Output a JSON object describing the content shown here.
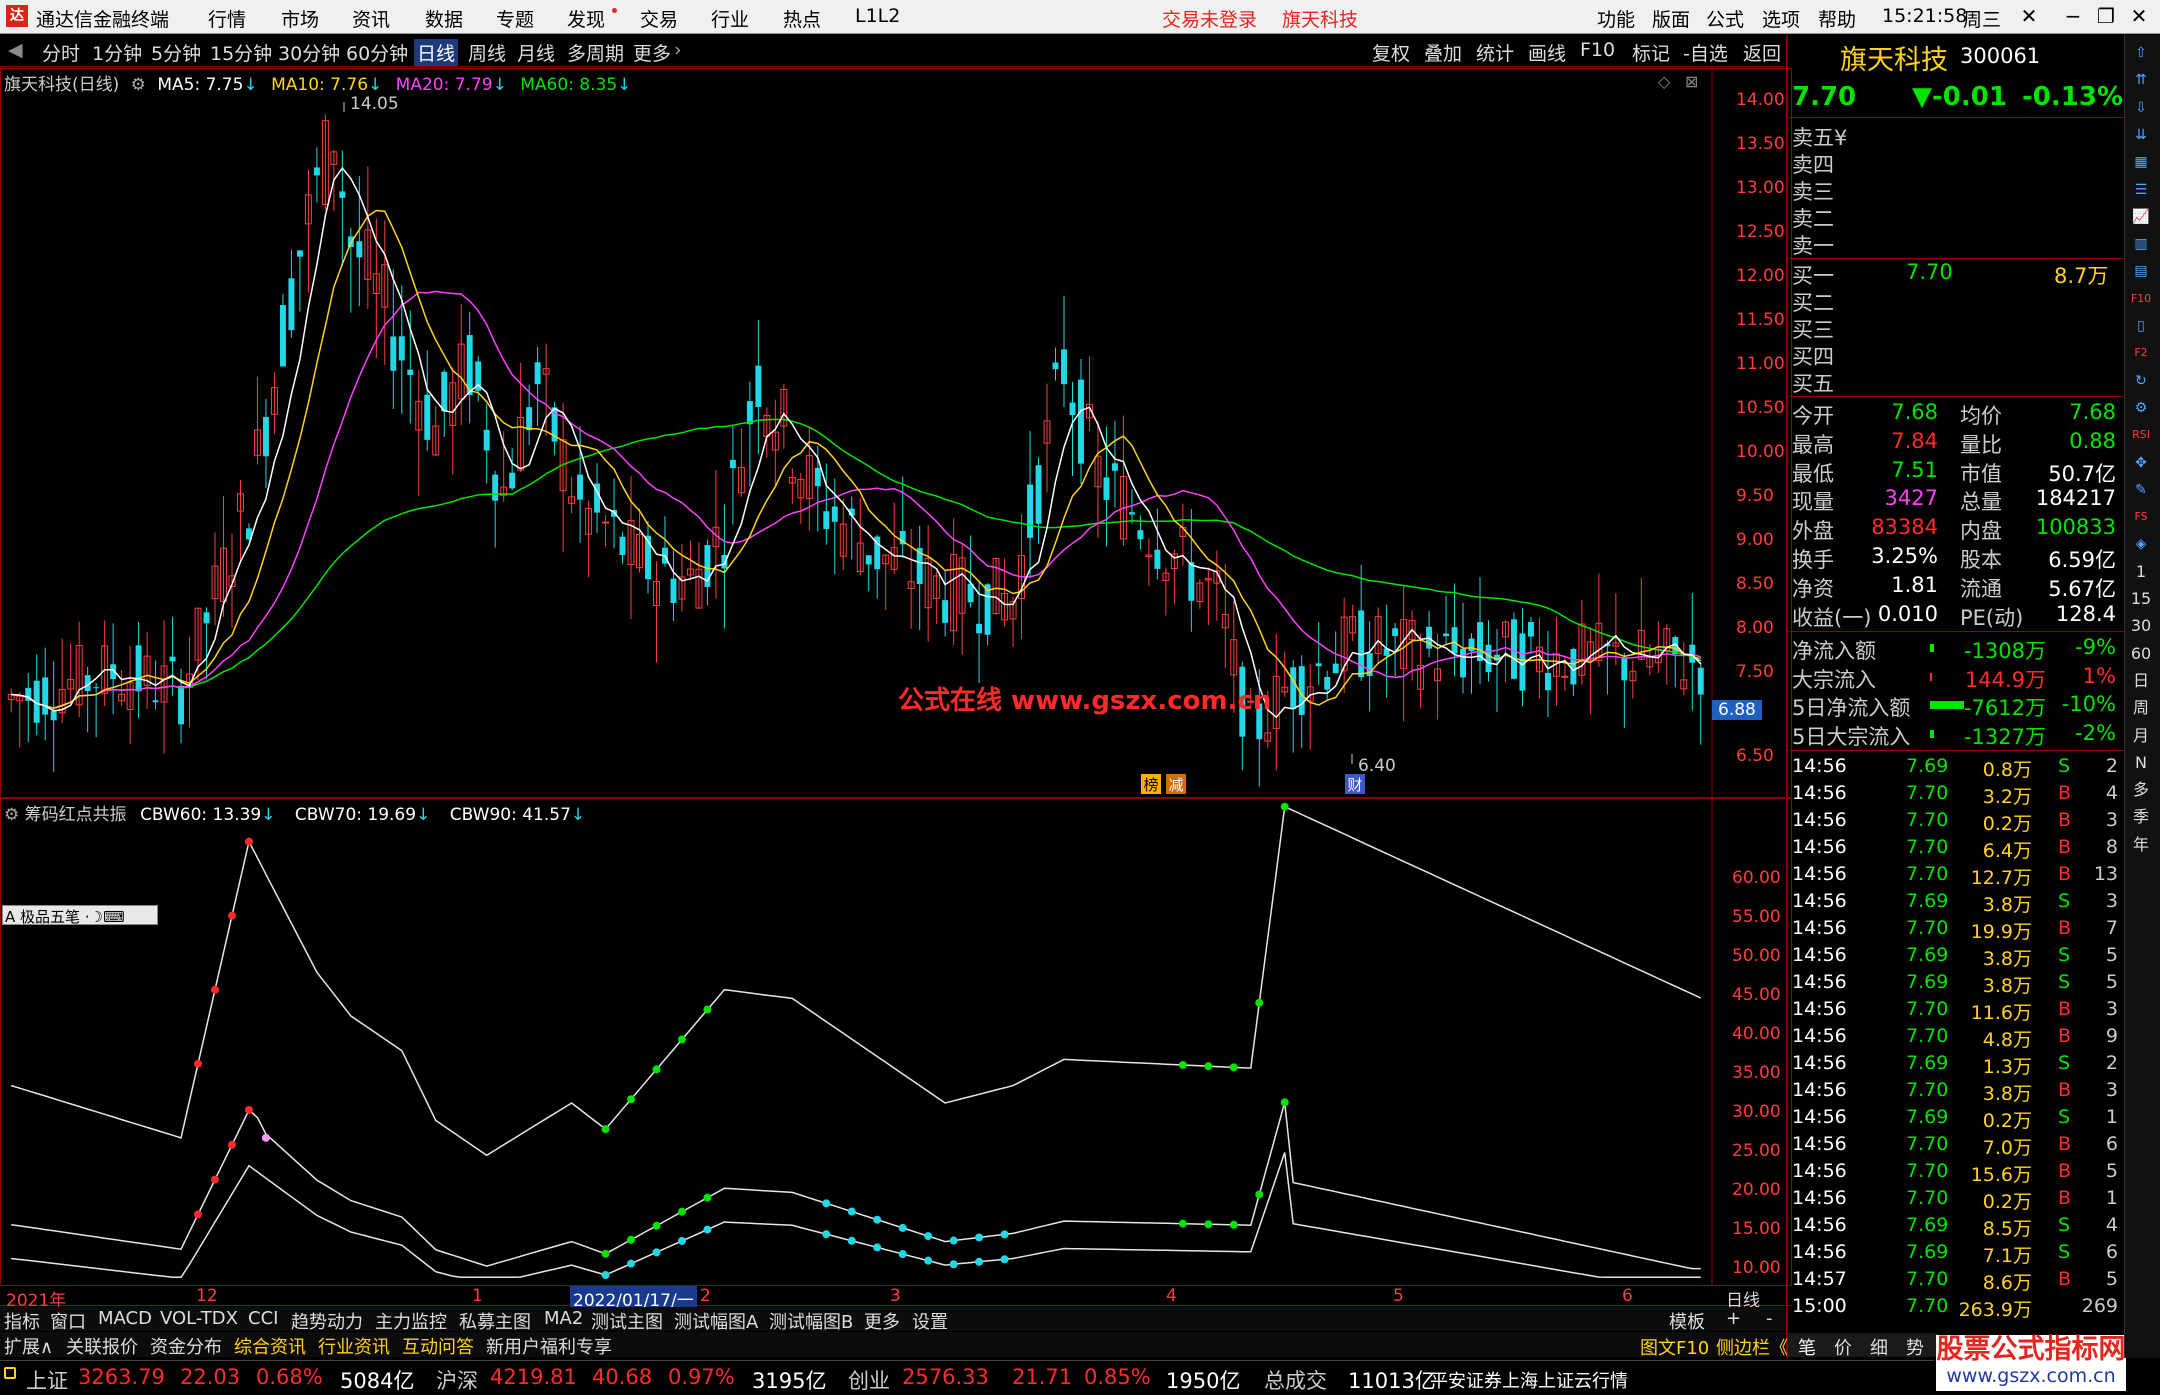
{
  "app": {
    "title": "通达信金融终端",
    "logo": "app-logo"
  },
  "menu": {
    "items": [
      "行情",
      "市场",
      "资讯",
      "数据",
      "专题",
      "发现",
      "交易",
      "行业",
      "热点",
      "L1L2"
    ],
    "trade_status": "交易未登录",
    "stock_name": "旗天科技",
    "right_items": [
      "功能",
      "版面",
      "公式",
      "选项",
      "帮助"
    ],
    "time": "15:21:58",
    "weekday": "周三"
  },
  "periods": {
    "items": [
      "分时",
      "1分钟",
      "5分钟",
      "15分钟",
      "30分钟",
      "60分钟",
      "日线",
      "周线",
      "月线",
      "多周期",
      "更多"
    ],
    "active": "日线",
    "right_items": [
      "复权",
      "叠加",
      "统计",
      "画线",
      "F10",
      "标记",
      "-自选",
      "返回"
    ]
  },
  "chart_header": {
    "name": "旗天科技(日线)",
    "ma5": "MA5: 7.75",
    "ma10": "MA10: 7.76",
    "ma20": "MA20: 7.79",
    "ma60": "MA60: 8.35"
  },
  "indicator_header": {
    "name": "筹码红点共振",
    "cbw60": "CBW60: 13.39",
    "cbw70": "CBW70: 19.69",
    "cbw90": "CBW90: 41.57"
  },
  "drawing_toolbar": {
    "label": "极品五笔"
  },
  "watermark": {
    "text": "公式在线 www.gszx.com.cn"
  },
  "annotations": {
    "high": "14.05",
    "low": "6.40",
    "badge1": "榜",
    "badge2": "减",
    "badge3": "财"
  },
  "price_ticks": [
    "14.00",
    "13.50",
    "13.00",
    "12.50",
    "12.00",
    "11.50",
    "11.00",
    "10.50",
    "10.00",
    "9.50",
    "9.00",
    "8.50",
    "8.00",
    "7.50",
    "6.88",
    "6.50"
  ],
  "ind_ticks": [
    "60.00",
    "55.00",
    "50.00",
    "45.00",
    "40.00",
    "35.00",
    "30.00",
    "25.00",
    "20.00",
    "15.00",
    "10.00"
  ],
  "x_axis": {
    "labels": [
      "2021年",
      "12",
      "1",
      "2022/01/17/一",
      "2",
      "3",
      "4",
      "5",
      "6"
    ],
    "period": "日线"
  },
  "chart_data": [
    {
      "type": "candlestick",
      "title": "旗天科技(日线)",
      "ylim": [
        6.2,
        14.3
      ],
      "series": [
        {
          "name": "MA5",
          "color": "#ffffff"
        },
        {
          "name": "MA10",
          "color": "#ffd21e"
        },
        {
          "name": "MA20",
          "color": "#ff40ff"
        },
        {
          "name": "MA60",
          "color": "#00e400"
        }
      ],
      "high": 14.05,
      "low": 6.4,
      "last_close": 7.7
    },
    {
      "type": "line",
      "title": "筹码红点共振",
      "ylim": [
        9,
        65
      ],
      "series": [
        {
          "name": "CBW90",
          "last": 41.57
        },
        {
          "name": "CBW70",
          "last": 19.69
        },
        {
          "name": "CBW60",
          "last": 13.39
        }
      ]
    }
  ],
  "quote": {
    "name": "旗天科技",
    "code": "300061",
    "price": "7.70",
    "change": "▼-0.01",
    "pct": "-0.13%",
    "asks": [
      "卖五",
      "卖四",
      "卖三",
      "卖二",
      "卖一"
    ],
    "ask_mark": "¥",
    "bids": [
      "买一",
      "买二",
      "买三",
      "买四",
      "买五"
    ],
    "bid1_price": "7.70",
    "bid1_vol": "8.7万",
    "stats": [
      [
        "今开",
        "7.68",
        "均价",
        "7.68"
      ],
      [
        "最高",
        "7.84",
        "量比",
        "0.88"
      ],
      [
        "最低",
        "7.51",
        "市值",
        "50.7亿"
      ],
      [
        "现量",
        "3427",
        "总量",
        "184217"
      ],
      [
        "外盘",
        "83384",
        "内盘",
        "100833"
      ],
      [
        "换手",
        "3.25%",
        "股本",
        "6.59亿"
      ],
      [
        "净资",
        "1.81",
        "流通",
        "5.67亿"
      ],
      [
        "收益(一)",
        "0.010",
        "PE(动)",
        "128.4"
      ]
    ],
    "flows": [
      [
        "净流入额",
        "-1308万",
        "-9%"
      ],
      [
        "大宗流入",
        "144.9万",
        "1%"
      ],
      [
        "5日净流入额",
        "-7612万",
        "-10%"
      ],
      [
        "5日大宗流入",
        "-1327万",
        "-2%"
      ]
    ]
  },
  "ticks": [
    [
      "14:56",
      "7.69",
      "0.8万",
      "S",
      "2"
    ],
    [
      "14:56",
      "7.70",
      "3.2万",
      "B",
      "4"
    ],
    [
      "14:56",
      "7.70",
      "0.2万",
      "B",
      "3"
    ],
    [
      "14:56",
      "7.70",
      "6.4万",
      "B",
      "8"
    ],
    [
      "14:56",
      "7.70",
      "12.7万",
      "B",
      "13"
    ],
    [
      "14:56",
      "7.69",
      "3.8万",
      "S",
      "3"
    ],
    [
      "14:56",
      "7.70",
      "19.9万",
      "B",
      "7"
    ],
    [
      "14:56",
      "7.69",
      "3.8万",
      "S",
      "5"
    ],
    [
      "14:56",
      "7.69",
      "3.8万",
      "S",
      "5"
    ],
    [
      "14:56",
      "7.70",
      "11.6万",
      "B",
      "3"
    ],
    [
      "14:56",
      "7.70",
      "4.8万",
      "B",
      "9"
    ],
    [
      "14:56",
      "7.69",
      "1.3万",
      "S",
      "2"
    ],
    [
      "14:56",
      "7.70",
      "3.8万",
      "B",
      "3"
    ],
    [
      "14:56",
      "7.69",
      "0.2万",
      "S",
      "1"
    ],
    [
      "14:56",
      "7.70",
      "7.0万",
      "B",
      "6"
    ],
    [
      "14:56",
      "7.70",
      "15.6万",
      "B",
      "5"
    ],
    [
      "14:56",
      "7.70",
      "0.2万",
      "B",
      "1"
    ],
    [
      "14:56",
      "7.69",
      "8.5万",
      "S",
      "4"
    ],
    [
      "14:56",
      "7.69",
      "7.1万",
      "S",
      "6"
    ],
    [
      "14:57",
      "7.70",
      "8.6万",
      "B",
      "5"
    ],
    [
      "15:00",
      "7.70",
      "263.9万",
      "",
      "269"
    ]
  ],
  "ind_tabs": [
    "指标",
    "窗口",
    "MACD",
    "VOL-TDX",
    "CCI",
    "趋势动力",
    "主力监控",
    "私募主图",
    "MA2",
    "测试主图",
    "测试幅图A",
    "测试幅图B",
    "更多",
    "设置"
  ],
  "ind_tabs_right": [
    "模板",
    "+",
    "-"
  ],
  "ext_tabs": [
    "扩展∧",
    "关联报价",
    "资金分布",
    "综合资讯",
    "行业资讯",
    "互动问答",
    "新用户福利专享"
  ],
  "right_buttons": [
    "图文F10",
    "侧边栏《",
    "笔",
    "价",
    "细",
    "势"
  ],
  "brand": {
    "text": "股票公式指标网",
    "url": "www.gszx.com.cn"
  },
  "index_bar": [
    {
      "name": "上证",
      "value": "3263.79",
      "chg": "22.03",
      "pct": "0.68%",
      "amt": "5084亿"
    },
    {
      "name": "沪深",
      "value": "4219.81",
      "chg": "40.68",
      "pct": "0.97%",
      "amt": "3195亿"
    },
    {
      "name": "创业",
      "value": "2576.33",
      "chg": "21.71",
      "pct": "0.85%",
      "amt": "1950亿"
    }
  ],
  "turnover": {
    "label": "总成交",
    "value": "11013亿",
    "source": "平安证券上海上证云行情"
  },
  "side_icons": [
    "up-arrow",
    "double-up",
    "down-arrow",
    "double-down",
    "grid",
    "list",
    "chart",
    "candle",
    "table",
    "f10",
    "doc",
    "f2",
    "circle-arrow",
    "gear",
    "rsi",
    "move",
    "pen",
    "fs",
    "map",
    "1",
    "15",
    "30",
    "60",
    "日",
    "周",
    "月",
    "N",
    "多",
    "季",
    "年"
  ]
}
